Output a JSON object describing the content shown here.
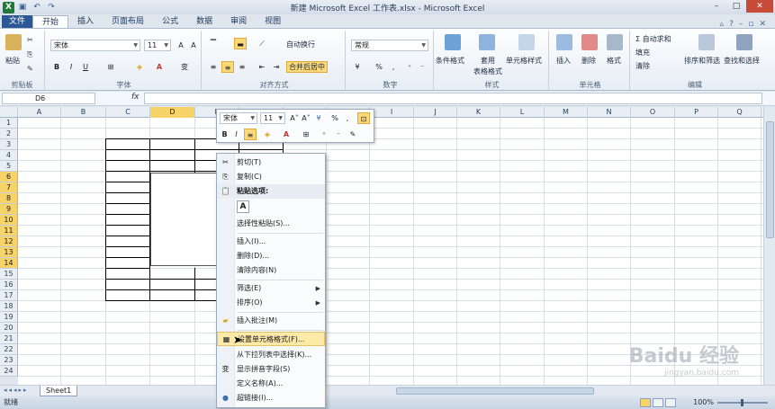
{
  "window": {
    "title": "新建 Microsoft Excel 工作表.xlsx - Microsoft Excel",
    "app_letter": "X"
  },
  "ribbon_tabs": [
    "文件",
    "开始",
    "插入",
    "页面布局",
    "公式",
    "数据",
    "审阅",
    "视图"
  ],
  "ribbon": {
    "clipboard": {
      "paste": "粘贴",
      "label": "剪贴板"
    },
    "font": {
      "name": "宋体",
      "size": "11",
      "bold": "B",
      "italic": "I",
      "underline": "U",
      "label": "字体"
    },
    "alignment": {
      "wrap": "自动换行",
      "merge": "合并后居中",
      "label": "对齐方式"
    },
    "number": {
      "format": "常规",
      "percent": "%",
      "comma": ",",
      "label": "数字"
    },
    "styles": {
      "conditional": "条件格式",
      "table": "套用",
      "table2": "表格格式",
      "cell_style": "单元格样式",
      "label": "样式"
    },
    "cells": {
      "insert": "插入",
      "delete": "删除",
      "format": "格式",
      "label": "单元格"
    },
    "editing": {
      "autosum": "Σ 自动求和",
      "fill": "填充",
      "clear": "清除",
      "sort": "排序和筛选",
      "find": "查找和选择",
      "label": "编辑"
    }
  },
  "formula_bar": {
    "name_box": "D6",
    "fx": "fx"
  },
  "columns": [
    "A",
    "B",
    "C",
    "D",
    "E",
    "F",
    "G",
    "H",
    "I",
    "J",
    "K",
    "L",
    "M",
    "N",
    "O",
    "P",
    "Q"
  ],
  "rows": [
    "1",
    "2",
    "3",
    "4",
    "5",
    "6",
    "7",
    "8",
    "9",
    "10",
    "11",
    "12",
    "13",
    "14",
    "15",
    "16",
    "17",
    "18",
    "19",
    "20",
    "21",
    "22",
    "23",
    "24"
  ],
  "selected_column": "D",
  "selected_rows": [
    "6",
    "7",
    "8",
    "9",
    "10",
    "11",
    "12",
    "13",
    "14"
  ],
  "mini_toolbar": {
    "font": "宋体",
    "size": "11",
    "grow": "A˄",
    "shrink": "A˅",
    "percent": "%",
    "comma": ",",
    "bold": "B",
    "italic": "I"
  },
  "context_menu": {
    "items": [
      {
        "label": "剪切(T)",
        "icon": "scissors-icon"
      },
      {
        "label": "复制(C)",
        "icon": "copy-icon"
      },
      {
        "label": "粘贴选项:",
        "icon": "paste-icon"
      },
      {
        "label": "选择性粘贴(S)..."
      },
      {
        "label": "插入(I)..."
      },
      {
        "label": "删除(D)..."
      },
      {
        "label": "清除内容(N)"
      },
      {
        "label": "筛选(E)"
      },
      {
        "label": "排序(O)"
      },
      {
        "label": "插入批注(M)",
        "icon": "comment-icon"
      },
      {
        "label": "设置单元格格式(F)...",
        "icon": "format-cells-icon"
      },
      {
        "label": "从下拉列表中选择(K)..."
      },
      {
        "label": "显示拼音字段(S)",
        "icon": "phonetic-icon"
      },
      {
        "label": "定义名称(A)..."
      },
      {
        "label": "超链接(I)...",
        "icon": "hyperlink-icon"
      }
    ],
    "paste_option": "A"
  },
  "sheet_tabs": [
    "Sheet1"
  ],
  "status": {
    "ready": "就绪",
    "zoom": "100%"
  },
  "watermark": {
    "main": "Baidu 经验",
    "sub": "jingyan.baidu.com"
  },
  "colors": {
    "file_tab": "#2b5797",
    "selection": "#f8d468",
    "menu_highlight": "#fde9a8"
  }
}
